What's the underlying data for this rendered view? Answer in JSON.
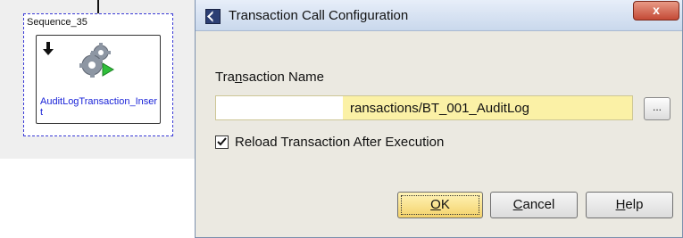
{
  "canvas": {
    "sequence_label": "Sequence_35",
    "activity_label": "AuditLogTransaction_Insert"
  },
  "dialog": {
    "title": "Transaction Call Configuration",
    "close_label": "x",
    "field_label_prefix": "Tra",
    "field_label_mnemonic": "n",
    "field_label_suffix": "saction Name",
    "transaction_value": "ransactions/BT_001_AuditLog",
    "browse_label": "...",
    "reload_checkbox": {
      "label": "Reload Transaction After Execution",
      "checked": true
    },
    "buttons": {
      "ok_mnemonic": "O",
      "ok_rest": "K",
      "cancel_mnemonic": "C",
      "cancel_rest": "ancel",
      "help_mnemonic": "H",
      "help_rest": "elp"
    }
  },
  "colors": {
    "activity_label": "#1a23d8",
    "sequence_border": "#3a3ad6",
    "input_highlight": "#fbf1a6",
    "ok_button": "#f4d26a"
  }
}
